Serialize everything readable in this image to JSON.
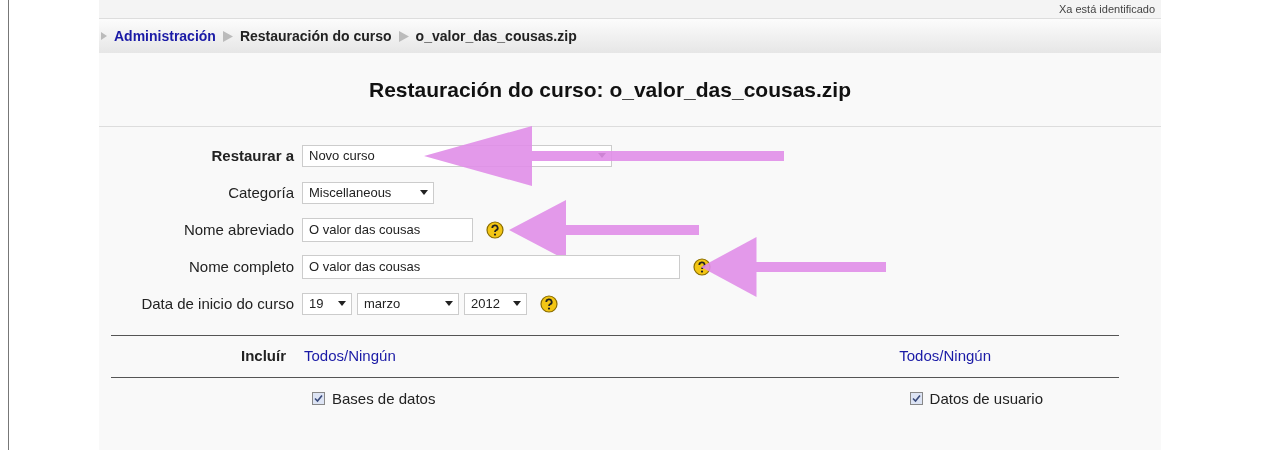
{
  "header": {
    "login_info": "Xa está identificado"
  },
  "breadcrumb": [
    {
      "label": "Administración",
      "kind": "link"
    },
    {
      "label": "Restauración do curso",
      "kind": "text"
    },
    {
      "label": "o_valor_das_cousas.zip",
      "kind": "text"
    }
  ],
  "heading": "Restauración do curso: o_valor_das_cousas.zip",
  "form": [
    {
      "label": "Restaurar a",
      "kind": "select",
      "value": "Novo curso",
      "bold": true,
      "help": false,
      "arrow": true
    },
    {
      "label": "Categoría",
      "kind": "select-small",
      "value": "Miscellaneous",
      "bold": false,
      "help": false,
      "arrow": false
    },
    {
      "label": "Nome abreviado",
      "kind": "input-short",
      "value": "O valor das cousas",
      "bold": false,
      "help": true,
      "arrow": true
    },
    {
      "label": "Nome completo",
      "kind": "input-long",
      "value": "O valor das cousas",
      "bold": false,
      "help": true,
      "arrow": true
    },
    {
      "label": "Data de inicio do curso",
      "kind": "date",
      "parts": [
        "19",
        "marzo",
        "2012"
      ],
      "bold": false,
      "help": true,
      "arrow": false
    }
  ],
  "include": {
    "label": "Incluír",
    "left_link": "Todos/Ningún",
    "right_link": "Todos/Ningún"
  },
  "options": [
    {
      "label": "Bases de datos",
      "checked": true
    },
    {
      "label": "Datos de usuario",
      "checked": true
    }
  ]
}
